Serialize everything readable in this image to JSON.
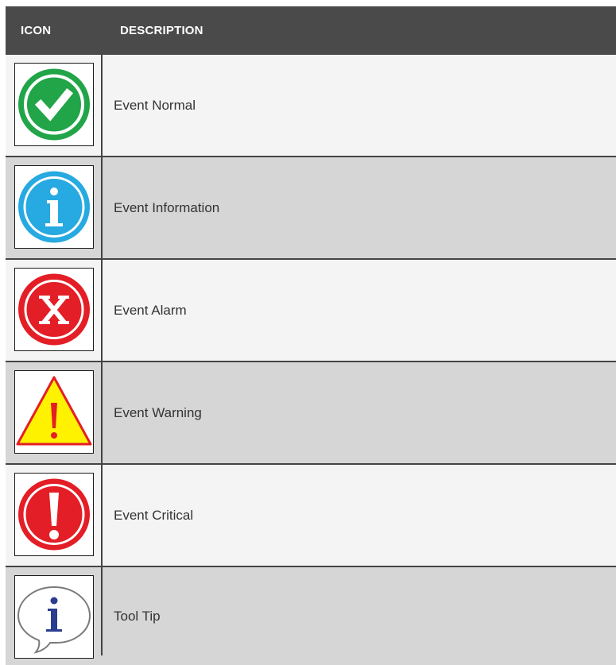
{
  "table": {
    "headers": {
      "icon": "ICON",
      "description": "DESCRIPTION"
    },
    "rows": [
      {
        "icon": "event-normal-icon",
        "description": "Event Normal",
        "color": "#21a548"
      },
      {
        "icon": "event-information-icon",
        "description": "Event Information",
        "color": "#27a9e1"
      },
      {
        "icon": "event-alarm-icon",
        "description": "Event Alarm",
        "color": "#e41e26"
      },
      {
        "icon": "event-warning-icon",
        "description": "Event Warning",
        "color": "#fff200"
      },
      {
        "icon": "event-critical-icon",
        "description": "Event Critical",
        "color": "#e41e26"
      },
      {
        "icon": "tool-tip-icon",
        "description": "Tool Tip",
        "color": "#2b3d8f"
      }
    ]
  }
}
